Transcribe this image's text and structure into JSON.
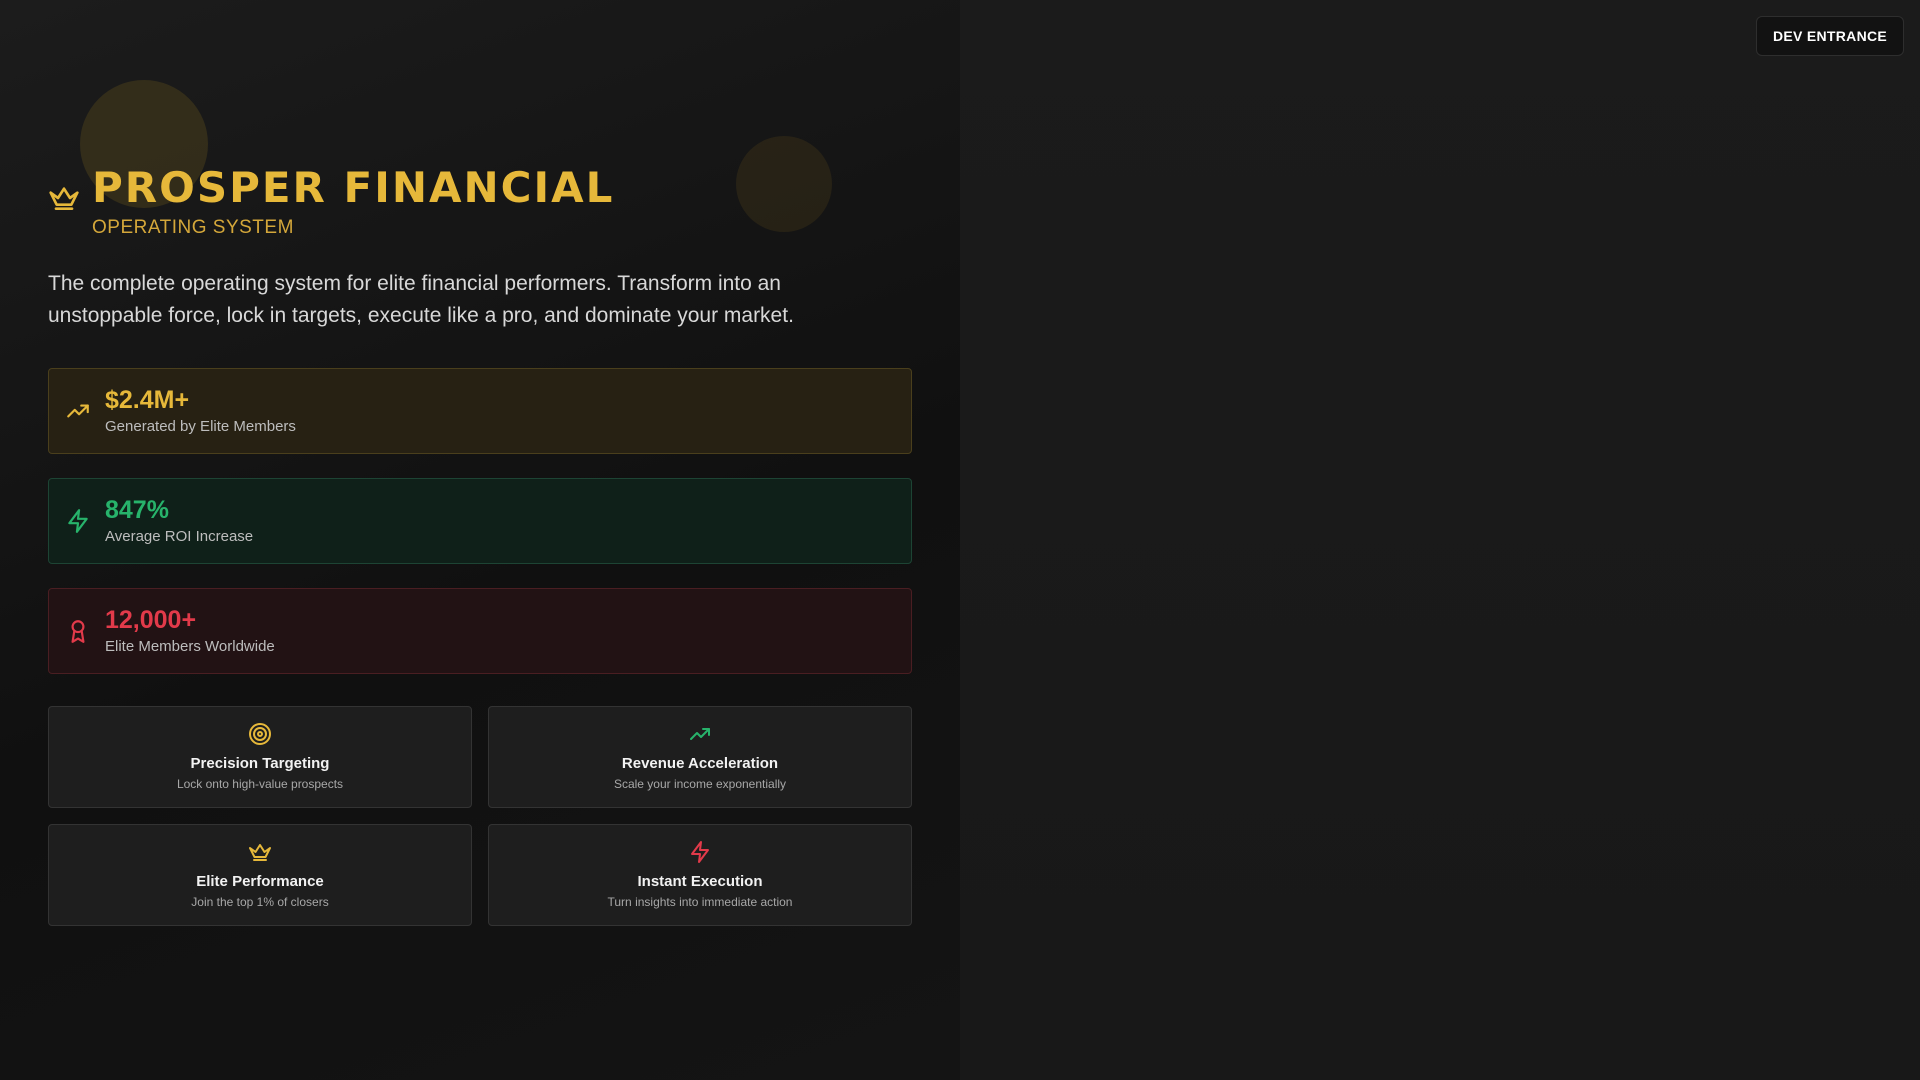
{
  "hero": {
    "title": "PROSPER FINANCIAL",
    "subtitle": "OPERATING SYSTEM",
    "description": "The complete operating system for elite financial performers. Transform into an unstoppable force, lock in targets, execute like a pro, and dominate your market."
  },
  "stats": [
    {
      "value": "$2.4M+",
      "label": "Generated by Elite Members",
      "icon": "trending-up-icon",
      "color": "#e6b83a"
    },
    {
      "value": "847%",
      "label": "Average ROI Increase",
      "icon": "lightning-icon",
      "color": "#27b36b"
    },
    {
      "value": "12,000+",
      "label": "Elite Members Worldwide",
      "icon": "award-icon",
      "color": "#e23a4a"
    }
  ],
  "features": [
    {
      "title": "Precision Targeting",
      "description": "Lock onto high-value prospects",
      "icon": "target-icon",
      "color": "#e6b83a"
    },
    {
      "title": "Revenue Acceleration",
      "description": "Scale your income exponentially",
      "icon": "trending-up-icon",
      "color": "#27b36b"
    },
    {
      "title": "Elite Performance",
      "description": "Join the top 1% of closers",
      "icon": "crown-icon",
      "color": "#e6b83a"
    },
    {
      "title": "Instant Execution",
      "description": "Turn insights into immediate action",
      "icon": "lightning-icon",
      "color": "#e23a4a"
    }
  ],
  "header": {
    "dev_button_label": "DEV ENTRANCE"
  },
  "colors": {
    "accent_gold": "#e6b83a",
    "accent_green": "#27b36b",
    "accent_red": "#e23a4a",
    "background": "#1a1a1a"
  }
}
